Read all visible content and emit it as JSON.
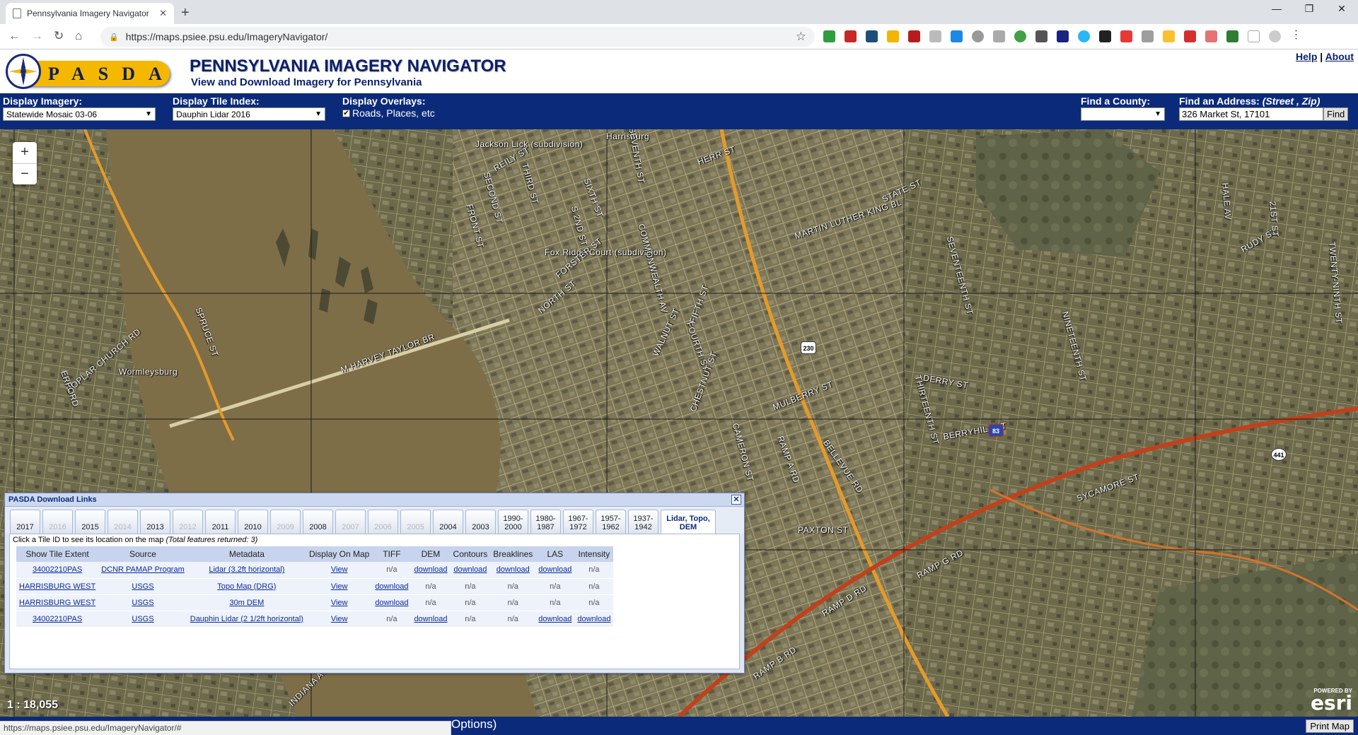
{
  "browser": {
    "tab_title": "Pennsylvania Imagery Navigator",
    "url": "https://maps.psiee.psu.edu/ImageryNavigator/"
  },
  "header": {
    "logo_text": "PASDA",
    "title": "PENNSYLVANIA IMAGERY NAVIGATOR",
    "subtitle": "View and Download Imagery for Pennsylvania",
    "help_link": "Help",
    "separator": "|",
    "about_link": "About"
  },
  "toolbar": {
    "display_imagery_label": "Display Imagery:",
    "display_imagery_value": "Statewide Mosaic 03-06",
    "tile_index_label": "Display Tile Index:",
    "tile_index_value": "Dauphin Lidar 2016",
    "overlays_label": "Display Overlays:",
    "overlays_option": "Roads, Places, etc",
    "overlays_checked": true,
    "county_label": "Find a County:",
    "county_value": "",
    "address_label": "Find an Address:",
    "address_hint": "(Street , Zip)",
    "address_value": "326 Market St, 17101",
    "find_button": "Find"
  },
  "map": {
    "zoom_in": "+",
    "zoom_out": "−",
    "scale": "1 : 18,055",
    "powered_by": "POWERED BY",
    "esri": "esri",
    "labels": {
      "l0": "Harrisburg",
      "l1": "Jackson Lick (subdivision)",
      "l2": "Fox Ridge Court (subdivision)",
      "l3": "Wormleysburg",
      "l4": "M HARVEY TAYLOR BR",
      "l5": "MARTIN LUTHER KING BL",
      "l6": "DERRY ST",
      "l7": "BERRYHILL ST",
      "l8": "MULBERRY ST",
      "l9": "PAXTON ST",
      "l10": "SYCAMORE ST",
      "l11": "RAMP G RD",
      "l12": "RAMP D RD",
      "l13": "RAMP B RD",
      "l14": "STATE ST",
      "l15": "FRONT ST",
      "l16": "SECOND ST",
      "l17": "THIRD ST",
      "l18": "SEVENTH ST",
      "l19": "HERR ST",
      "l20": "NORTH ST",
      "l21": "FORSTER ST",
      "l22": "COMMONWEALTH AV",
      "l23": "FIFTH ST",
      "l24": "FOURTH ST",
      "l25": "WALNUT ST",
      "l26": "CHESTNUT ST",
      "l27": "THIRTEENTH ST",
      "l28": "NINETEENTH ST",
      "l29": "SEVENTEENTH ST",
      "l30": "HALE AV",
      "l31": "RUDY ST",
      "l32": "POPLAR CHURCH RD",
      "l33": "SPRUCE ST",
      "l34": "INDIANA AV",
      "l35": "RAMP A RD",
      "l36": "CAMERON ST",
      "l37": "REILY ST",
      "l38": "SIXTH ST",
      "l39": "S 2ND ST",
      "l40": "ERFORD",
      "l41": "21ST ST",
      "l42": "TWENTY-NINTH ST",
      "l43": "BELLEVUE RD"
    },
    "shields": {
      "s230": "230",
      "s83": "83",
      "s441": "441"
    }
  },
  "download_panel": {
    "title": "PASDA Download Links",
    "close": "✕",
    "years": [
      {
        "label": "2017",
        "enabled": true
      },
      {
        "label": "2016",
        "enabled": false
      },
      {
        "label": "2015",
        "enabled": true
      },
      {
        "label": "2014",
        "enabled": false
      },
      {
        "label": "2013",
        "enabled": true
      },
      {
        "label": "2012",
        "enabled": false
      },
      {
        "label": "2011",
        "enabled": true
      },
      {
        "label": "2010",
        "enabled": true
      },
      {
        "label": "2009",
        "enabled": false
      },
      {
        "label": "2008",
        "enabled": true
      },
      {
        "label": "2007",
        "enabled": false
      },
      {
        "label": "2006",
        "enabled": false
      },
      {
        "label": "2005",
        "enabled": false
      },
      {
        "label": "2004",
        "enabled": true
      },
      {
        "label": "2003",
        "enabled": true
      },
      {
        "label": "1990-2000",
        "enabled": true
      },
      {
        "label": "1980-1987",
        "enabled": true
      },
      {
        "label": "1967-1972",
        "enabled": true
      },
      {
        "label": "1957-1962",
        "enabled": true
      },
      {
        "label": "1937-1942",
        "enabled": true
      },
      {
        "label": "Lidar, Topo, DEM",
        "enabled": true,
        "active": true
      }
    ],
    "hint": "Click a Tile ID to see its location on the map",
    "hint_total": "(Total features returned: 3)",
    "columns": [
      "Show Tile Extent",
      "Source",
      "Metadata",
      "Display On Map",
      "TIFF",
      "DEM",
      "Contours",
      "Breaklines",
      "LAS",
      "Intensity"
    ],
    "rows": [
      [
        "34002210PAS",
        "DCNR PAMAP Program",
        "Lidar (3.2ft horizontal)",
        "View",
        "n/a",
        "download",
        "download",
        "download",
        "download",
        "n/a"
      ],
      [
        "HARRISBURG WEST",
        "USGS",
        "Topo Map (DRG)",
        "View",
        "download",
        "n/a",
        "n/a",
        "n/a",
        "n/a",
        "n/a"
      ],
      [
        "HARRISBURG WEST",
        "USGS",
        "30m DEM",
        "View",
        "download",
        "n/a",
        "n/a",
        "n/a",
        "n/a",
        "n/a"
      ],
      [
        "34002210PAS",
        "USGS",
        "Dauphin Lidar (2 1/2ft horizontal)",
        "View",
        "n/a",
        "download",
        "n/a",
        "n/a",
        "download",
        "download"
      ]
    ]
  },
  "footer": {
    "status_url": "https://maps.psiee.psu.edu/ImageryNavigator/#",
    "options_link": "Options)",
    "print_button": "Print Map"
  }
}
